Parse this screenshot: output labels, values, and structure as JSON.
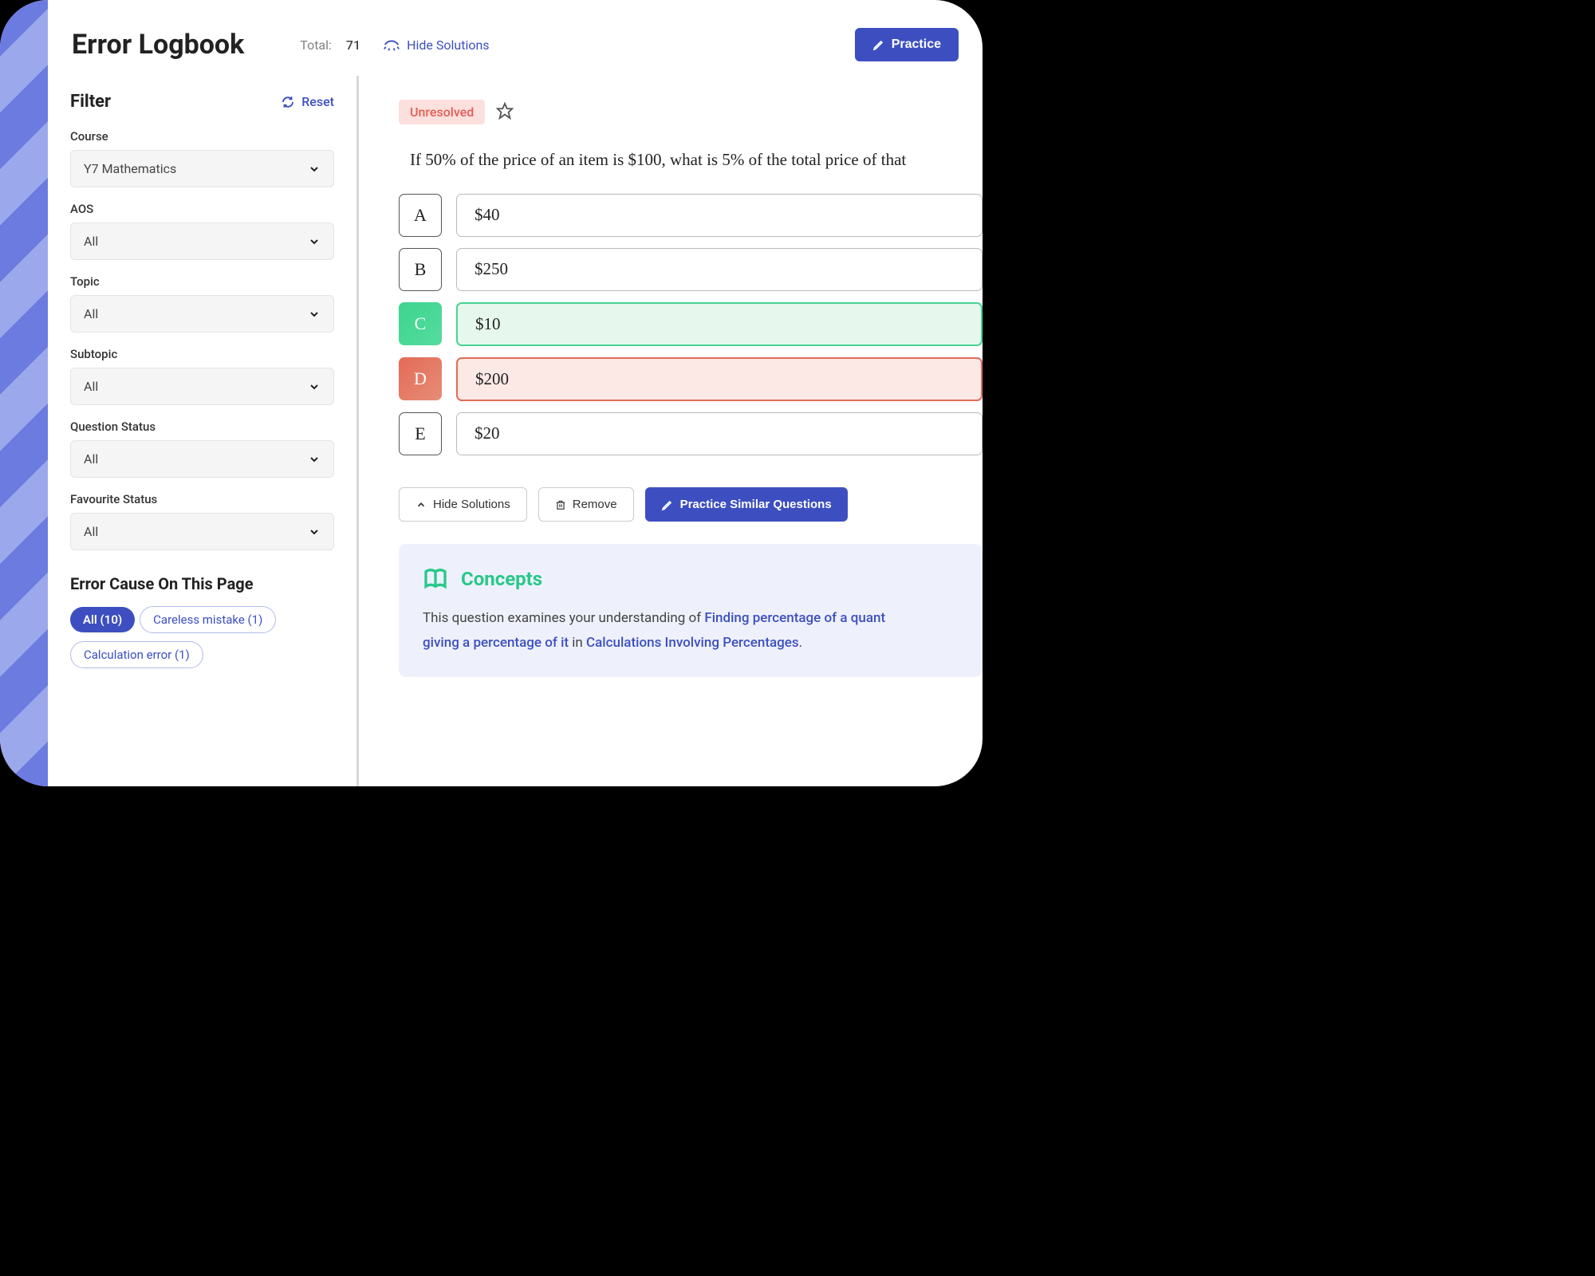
{
  "header": {
    "title": "Error Logbook",
    "total_label": "Total:",
    "total_value": "71",
    "hide_solutions": "Hide Solutions",
    "practice_btn": "Practice"
  },
  "filter": {
    "title": "Filter",
    "reset": "Reset",
    "groups": [
      {
        "label": "Course",
        "value": "Y7 Mathematics"
      },
      {
        "label": "AOS",
        "value": "All"
      },
      {
        "label": "Topic",
        "value": "All"
      },
      {
        "label": "Subtopic",
        "value": "All"
      },
      {
        "label": "Question Status",
        "value": "All"
      },
      {
        "label": "Favourite Status",
        "value": "All"
      }
    ]
  },
  "error_cause": {
    "title": "Error Cause On This Page",
    "pills": [
      {
        "label": "All (10)",
        "active": true
      },
      {
        "label": "Careless mistake (1)",
        "active": false
      },
      {
        "label": "Calculation error (1)",
        "active": false
      }
    ]
  },
  "question": {
    "status": "Unresolved",
    "text": "If 50% of the price of an item is $100, what is 5% of the total price of that",
    "answers": [
      {
        "letter": "A",
        "text": "$40",
        "state": ""
      },
      {
        "letter": "B",
        "text": "$250",
        "state": ""
      },
      {
        "letter": "C",
        "text": "$10",
        "state": "correct"
      },
      {
        "letter": "D",
        "text": "$200",
        "state": "wrong"
      },
      {
        "letter": "E",
        "text": "$20",
        "state": ""
      }
    ]
  },
  "actions": {
    "hide": "Hide Solutions",
    "remove": "Remove",
    "practice_similar": "Practice Similar Questions"
  },
  "concepts": {
    "title": "Concepts",
    "intro": "This question examines your understanding of ",
    "link1": "Finding percentage of a quant",
    "mid": "giving a percentage of it",
    "mid_prefix": " in ",
    "link2": "Calculations Involving Percentages",
    "suffix": "."
  }
}
